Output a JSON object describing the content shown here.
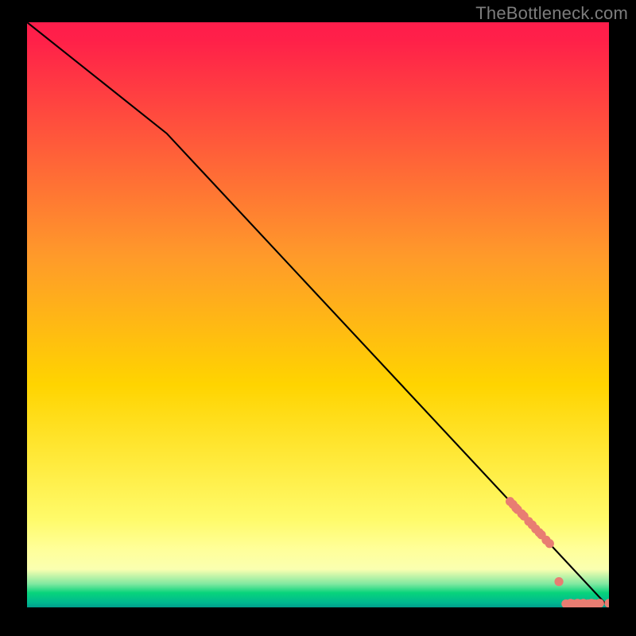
{
  "attribution": "TheBottleneck.com",
  "colors": {
    "line": "#000000",
    "points": "#e87d72",
    "gradient_top": "#ff1d4b",
    "gradient_mid": "#ffd400",
    "gradient_low": "#ffff88",
    "gradient_green": "#00d57a",
    "gradient_teal": "#009e8c"
  },
  "chart_data": {
    "type": "line",
    "title": "",
    "xlabel": "",
    "ylabel": "",
    "xlim": [
      0,
      100
    ],
    "ylim": [
      0,
      100
    ],
    "x": [
      0,
      24,
      100
    ],
    "values": [
      100,
      81,
      0
    ],
    "points": [
      {
        "x": 83,
        "y": 18.1
      },
      {
        "x": 83.5,
        "y": 17.6
      },
      {
        "x": 84,
        "y": 17.0
      },
      {
        "x": 84.3,
        "y": 16.7
      },
      {
        "x": 85,
        "y": 16.0
      },
      {
        "x": 85.4,
        "y": 15.6
      },
      {
        "x": 86.2,
        "y": 14.7
      },
      {
        "x": 86.8,
        "y": 14.1
      },
      {
        "x": 87.4,
        "y": 13.4
      },
      {
        "x": 88,
        "y": 12.8
      },
      {
        "x": 88.4,
        "y": 12.4
      },
      {
        "x": 89.2,
        "y": 11.5
      },
      {
        "x": 89.8,
        "y": 10.9
      },
      {
        "x": 91.4,
        "y": 4.4
      },
      {
        "x": 92.6,
        "y": 0.6
      },
      {
        "x": 93.4,
        "y": 0.7
      },
      {
        "x": 93.8,
        "y": 0.6
      },
      {
        "x": 94.6,
        "y": 0.7
      },
      {
        "x": 95,
        "y": 0.6
      },
      {
        "x": 95.6,
        "y": 0.7
      },
      {
        "x": 96.4,
        "y": 0.6
      },
      {
        "x": 97,
        "y": 0.7
      },
      {
        "x": 97.6,
        "y": 0.6
      },
      {
        "x": 98.4,
        "y": 0.7
      },
      {
        "x": 100,
        "y": 0.7
      }
    ]
  }
}
